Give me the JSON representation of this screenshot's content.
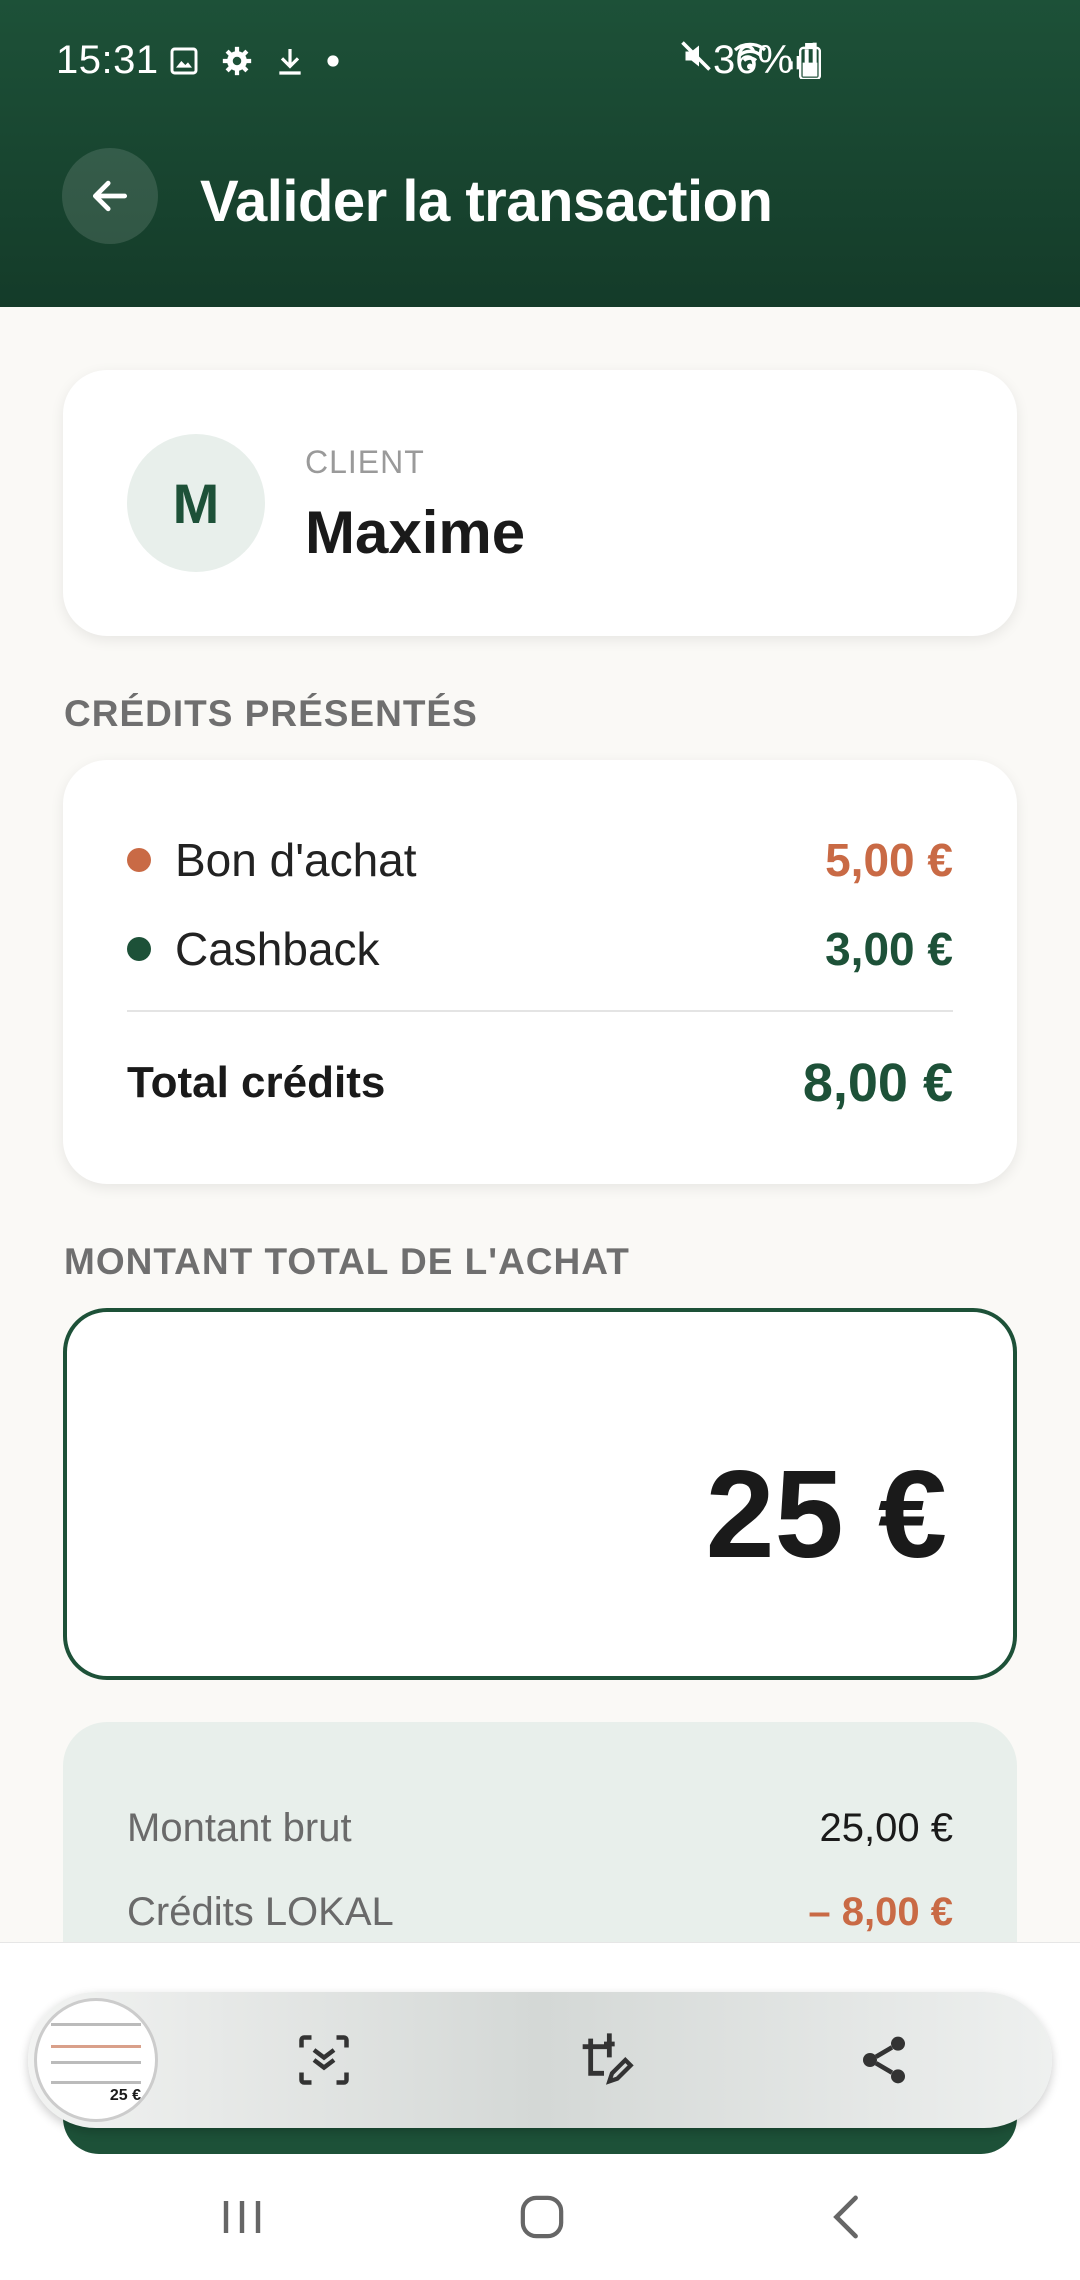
{
  "status": {
    "time": "15:31",
    "battery": "36%"
  },
  "header": {
    "title": "Valider la transaction"
  },
  "client": {
    "initial": "M",
    "label": "CLIENT",
    "name": "Maxime"
  },
  "credits": {
    "section_label": "CRÉDITS PRÉSENTÉS",
    "items": [
      {
        "name": "Bon d'achat",
        "value": "5,00 €",
        "color": "#C96A45"
      },
      {
        "name": "Cashback",
        "value": "3,00 €",
        "color": "#1D5138"
      }
    ],
    "total_label": "Total crédits",
    "total_value": "8,00 €"
  },
  "purchase": {
    "section_label": "MONTANT TOTAL DE L'ACHAT",
    "amount": "25 €"
  },
  "summary": {
    "gross_label": "Montant brut",
    "gross_value": "25,00 €",
    "credits_label": "Crédits LOKAL",
    "credits_value": "– 8,00 €"
  },
  "colors": {
    "brand_green": "#1D5138",
    "accent_orange": "#C96A45"
  },
  "toolbar": {
    "icons": [
      "scroll-capture-icon",
      "crop-edit-icon",
      "share-icon"
    ]
  },
  "navbar": {
    "icons": [
      "recents-icon",
      "home-icon",
      "back-icon"
    ]
  }
}
